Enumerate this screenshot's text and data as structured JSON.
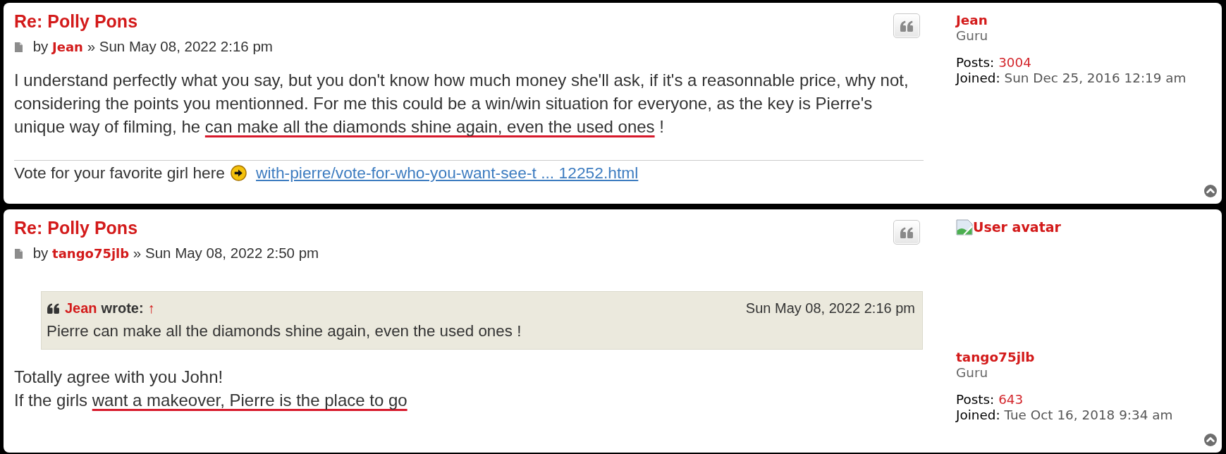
{
  "posts": [
    {
      "title": "Re: Polly Pons",
      "byline": {
        "prefix": "by",
        "author": "Jean",
        "separator": "»",
        "date": "Sun May 08, 2022 2:16 pm"
      },
      "body": [
        {
          "segments": [
            {
              "text": "I understand perfectly what you say, but you don't know how much money she'll ask, if it's a reasonnable price, why not, considering the points you mentionned. For me this could be a win/win situation for everyone, as the key is Pierre's unique way of filming, he ",
              "marked": false
            },
            {
              "text": "can make all the diamonds shine again, even the used ones",
              "marked": true
            },
            {
              "text": " !",
              "marked": false
            }
          ]
        }
      ],
      "signature": {
        "text": "Vote for your favorite girl here",
        "link": "with-pierre/vote-for-who-you-want-see-t ... 12252.html"
      },
      "profile": {
        "username": "Jean",
        "rank": "Guru",
        "posts_label": "Posts:",
        "posts": "3004",
        "joined_label": "Joined:",
        "joined": "Sun Dec 25, 2016 12:19 am"
      }
    },
    {
      "title": "Re: Polly Pons",
      "byline": {
        "prefix": "by",
        "author": "tango75jlb",
        "separator": "»",
        "date": "Sun May 08, 2022 2:50 pm"
      },
      "quote": {
        "author": "Jean",
        "wrote": "wrote:",
        "arrow": "↑",
        "date": "Sun May 08, 2022 2:16 pm",
        "text": "Pierre can make all the diamonds shine again, even the used ones !"
      },
      "body": [
        {
          "segments": [
            {
              "text": "Totally agree with you John!",
              "marked": false
            }
          ]
        },
        {
          "segments": [
            {
              "text": "If the girls ",
              "marked": false
            },
            {
              "text": "want a makeover, Pierre is the place to go",
              "marked": true
            }
          ]
        }
      ],
      "profile": {
        "avatar_alt": "User avatar",
        "username": "tango75jlb",
        "rank": "Guru",
        "posts_label": "Posts:",
        "posts": "643",
        "joined_label": "Joined:",
        "joined": "Tue Oct 16, 2018 9:34 am"
      }
    }
  ]
}
